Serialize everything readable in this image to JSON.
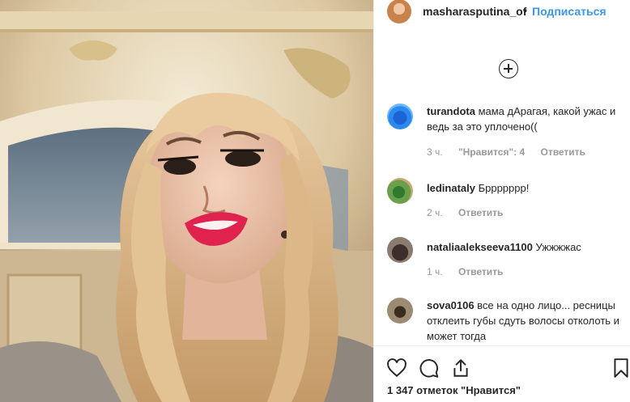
{
  "post": {
    "username": "masharasputina_of",
    "separator": "•",
    "follow_label": "Подписаться",
    "likes_text": "1 347 отметок \"Нравится\""
  },
  "comments": [
    {
      "username": "turandota",
      "text": " мама дАрагая, какой ужас и ведь за это уплочено((",
      "time": "3 ч.",
      "likes": "\"Нравится\": 4",
      "reply": "Ответить"
    },
    {
      "username": "ledinataly",
      "text": " Бррррррр!",
      "time": "2 ч.",
      "likes": "",
      "reply": "Ответить"
    },
    {
      "username": "nataliaalekseeva1100",
      "text": " Ужжжжас",
      "time": "1 ч.",
      "likes": "",
      "reply": "Ответить"
    },
    {
      "username": "sova0106",
      "text": " все на одно лицо... ресницы отклеить губы сдуть волосы отколоть и может тогда",
      "time": "",
      "likes": "",
      "reply": ""
    }
  ],
  "icons": {
    "load_more": "plus-circle-icon",
    "like": "heart-icon",
    "comment": "comment-bubble-icon",
    "share": "share-icon",
    "save": "bookmark-icon"
  },
  "colors": {
    "accent": "#3897f0",
    "text": "#262626",
    "muted": "#999999"
  }
}
